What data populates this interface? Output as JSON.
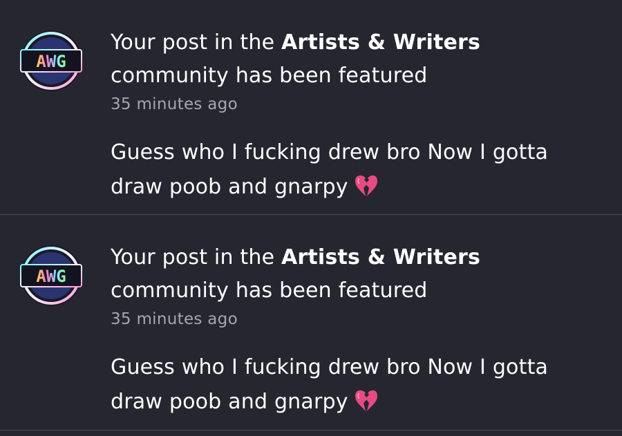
{
  "notifications": [
    {
      "avatar": {
        "label": "AWG",
        "icon": "awg-community-icon"
      },
      "headline_prefix": "Your post in the ",
      "community": "Artists & Writers",
      "headline_suffix": " community has been featured",
      "time": "35 minutes ago",
      "post_text": "Guess who I fucking drew bro Now I gotta draw poob and gnarpy",
      "emoji": "broken-heart-icon"
    },
    {
      "avatar": {
        "label": "AWG",
        "icon": "awg-community-icon"
      },
      "headline_prefix": "Your post in the ",
      "community": "Artists & Writers",
      "headline_suffix": " community has been featured",
      "time": "35 minutes ago",
      "post_text": "Guess who I fucking drew bro Now I gotta draw poob and gnarpy",
      "emoji": "broken-heart-icon"
    }
  ],
  "colors": {
    "background": "#262630",
    "divider": "#4a4a55",
    "secondary_text": "#a6a6b0",
    "emoji": "#e84a82"
  }
}
